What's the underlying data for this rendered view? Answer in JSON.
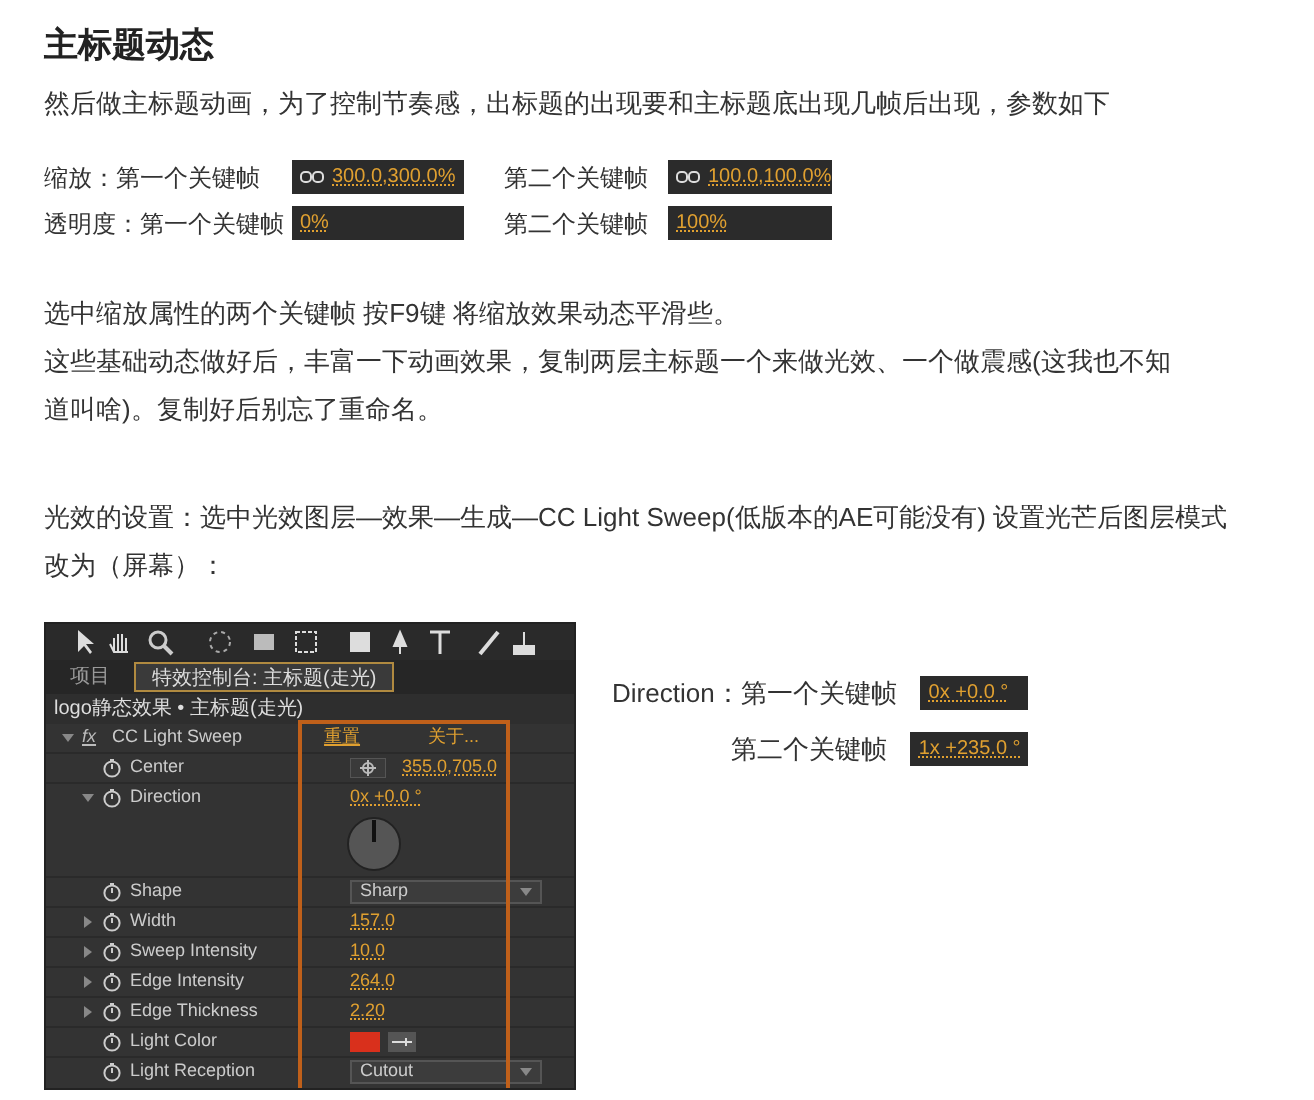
{
  "title": "主标题动态",
  "intro": "然后做主标题动画，为了控制节奏感，出标题的出现要和主标题底出现几帧后出现，参数如下",
  "param_rows": [
    {
      "label": "缩放：第一个关键帧",
      "value": "300.0,300.0%",
      "linked": true,
      "label_2": "第二个关键帧",
      "value_2": "100.0,100.0%",
      "linked_2": true
    },
    {
      "label": "透明度：第一个关键帧",
      "value": "0%",
      "linked": false,
      "label_2": "第二个关键帧",
      "value_2": "100%",
      "linked_2": false
    }
  ],
  "notes": [
    "选中缩放属性的两个关键帧 按F9键 将缩放效果动态平滑些。",
    "这些基础动态做好后，丰富一下动画效果，复制两层主标题一个来做光效、一个做震感(这我也不知道叫啥)。复制好后别忘了重命名。"
  ],
  "light_note": "光效的设置：选中光效图层—效果—生成—CC Light  Sweep(低版本的AE可能没有)  设置光芒后图层模式改为（屏幕）：",
  "ae_panel": {
    "tabs": [
      {
        "label": "项目",
        "selected": false
      },
      {
        "label": "特效控制台: 主标题(走光)",
        "selected": true
      }
    ],
    "layer_path": "logo静态效果 • 主标题(走光)",
    "effect": {
      "fx_label": "fx",
      "name": "CC Light Sweep",
      "expanded": true,
      "reset": "重置",
      "about": "关于..."
    },
    "properties": [
      {
        "name": "Center",
        "kind": "point",
        "value": "355.0,705.0",
        "expandable": false
      },
      {
        "name": "Direction",
        "kind": "angle",
        "value": "0x +0.0 °",
        "expandable": true,
        "expanded": true
      },
      {
        "name": "Shape",
        "kind": "popup",
        "value": "Sharp",
        "expandable": false
      },
      {
        "name": "Width",
        "kind": "number",
        "value": "157.0",
        "expandable": true,
        "expanded": false
      },
      {
        "name": "Sweep Intensity",
        "kind": "number",
        "value": "10.0",
        "expandable": true,
        "expanded": false
      },
      {
        "name": "Edge Intensity",
        "kind": "number",
        "value": "264.0",
        "expandable": true,
        "expanded": false
      },
      {
        "name": "Edge Thickness",
        "kind": "number",
        "value": "2.20",
        "expandable": true,
        "expanded": false
      },
      {
        "name": "Light Color",
        "kind": "color",
        "color": "#d9301c",
        "expandable": false
      },
      {
        "name": "Light Reception",
        "kind": "popup",
        "value": "Cutout",
        "expandable": false
      }
    ]
  },
  "direction_keys": [
    {
      "label": "Direction：第一个关键帧",
      "value": "0x +0.0 °"
    },
    {
      "label": "第二个关键帧",
      "value": "1x +235.0 °"
    }
  ]
}
